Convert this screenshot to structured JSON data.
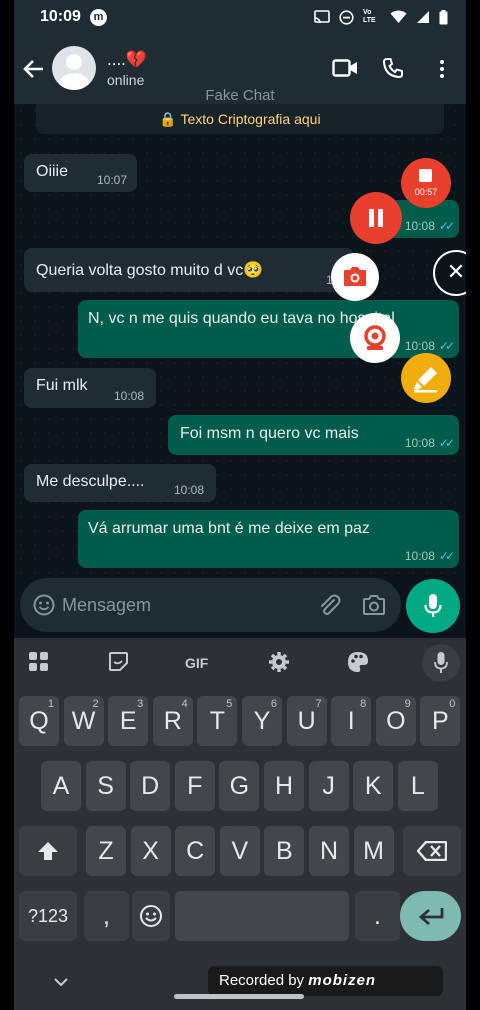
{
  "status_bar": {
    "time": "10:09",
    "app_badge": "m",
    "network": "Vo LTE"
  },
  "header": {
    "back_icon": "arrow-left-icon",
    "contact_name": "....💔",
    "contact_status": "online"
  },
  "chat": {
    "title": "Fake Chat",
    "encryption_notice": "🔒 Texto Criptografia aqui",
    "messages": [
      {
        "dir": "in",
        "text": "Oiiie",
        "time": "10:07"
      },
      {
        "dir": "out",
        "text": "",
        "time": "10:08"
      },
      {
        "dir": "in",
        "text": "Queria volta gosto muito d vc🥺",
        "time": "10:08"
      },
      {
        "dir": "out",
        "text": "N, vc n me quis quando eu tava no hospital",
        "time": "10:08"
      },
      {
        "dir": "in",
        "text": "Fui mlk",
        "time": "10:08"
      },
      {
        "dir": "out",
        "text": "Foi msm n quero vc mais",
        "time": "10:08"
      },
      {
        "dir": "in",
        "text": "Me desculpe....",
        "time": "10:08"
      },
      {
        "dir": "out",
        "text": "Vá arrumar uma bnt é me deixe em paz",
        "time": "10:08"
      }
    ],
    "read_ticks": "✓✓"
  },
  "recorder": {
    "elapsed": "00:57",
    "close_symbol": "✕"
  },
  "composer": {
    "placeholder": "Mensagem"
  },
  "keyboard": {
    "tools": {
      "gif": "GIF"
    },
    "row1": [
      {
        "k": "Q",
        "h": "1"
      },
      {
        "k": "W",
        "h": "2"
      },
      {
        "k": "E",
        "h": "3"
      },
      {
        "k": "R",
        "h": "4"
      },
      {
        "k": "T",
        "h": "5"
      },
      {
        "k": "Y",
        "h": "6"
      },
      {
        "k": "U",
        "h": "7"
      },
      {
        "k": "I",
        "h": "8"
      },
      {
        "k": "O",
        "h": "9"
      },
      {
        "k": "P",
        "h": "0"
      }
    ],
    "row2": [
      "A",
      "S",
      "D",
      "F",
      "G",
      "H",
      "J",
      "K",
      "L"
    ],
    "row3": [
      "Z",
      "X",
      "C",
      "V",
      "B",
      "N",
      "M"
    ],
    "symbols_key": "?123",
    "comma_key": ",",
    "period_key": "."
  },
  "watermark": {
    "prefix": "Recorded by",
    "brand": "mobizen"
  },
  "colors": {
    "outgoing": "#005c4b",
    "incoming": "#202c33",
    "accent": "#00a884",
    "record": "#e8402c"
  }
}
